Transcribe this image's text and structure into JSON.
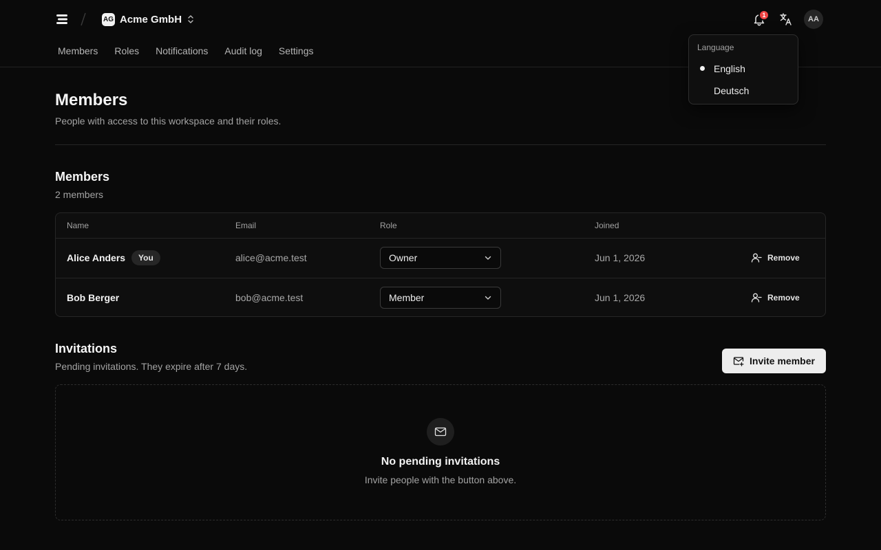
{
  "header": {
    "workspace_initials": "AG",
    "workspace_name": "Acme GmbH",
    "notifications_count": "1",
    "user_initials": "AA"
  },
  "tabs": [
    {
      "label": "Members"
    },
    {
      "label": "Roles"
    },
    {
      "label": "Notifications"
    },
    {
      "label": "Audit log"
    },
    {
      "label": "Settings"
    }
  ],
  "page": {
    "title": "Members",
    "subtitle": "People with access to this workspace and their roles."
  },
  "members": {
    "title": "Members",
    "count": "2 members",
    "columns": {
      "name": "Name",
      "email": "Email",
      "role": "Role",
      "joined": "Joined"
    },
    "rows": [
      {
        "name": "Alice Anders",
        "badge": "You",
        "email": "alice@acme.test",
        "role": "Owner",
        "joined": "Jun 1, 2026",
        "action": "Remove"
      },
      {
        "name": "Bob Berger",
        "email": "bob@acme.test",
        "role": "Member",
        "joined": "Jun 1, 2026",
        "action": "Remove"
      }
    ]
  },
  "invitations": {
    "title": "Invitations",
    "subtitle": "Pending invitations. They expire after 7 days.",
    "invite_label": "Invite member",
    "empty_title": "No pending invitations",
    "empty_subtitle": "Invite people with the button above."
  },
  "language_menu": {
    "label": "Language",
    "options": [
      {
        "label": "English",
        "selected": true
      },
      {
        "label": "Deutsch",
        "selected": false
      }
    ]
  },
  "icons": {
    "logo": "stacked-lines-logo-icon",
    "workspace_switch": "chevrons-up-down-icon",
    "notifications": "bell-icon",
    "language": "translate-icon",
    "select": "chevron-down-icon",
    "remove": "user-minus-icon",
    "invite": "mail-plus-icon",
    "empty": "mail-icon"
  },
  "colors": {
    "background": "#0a0a0a",
    "badge": "#ef4444",
    "primary_button": "#ededed"
  }
}
